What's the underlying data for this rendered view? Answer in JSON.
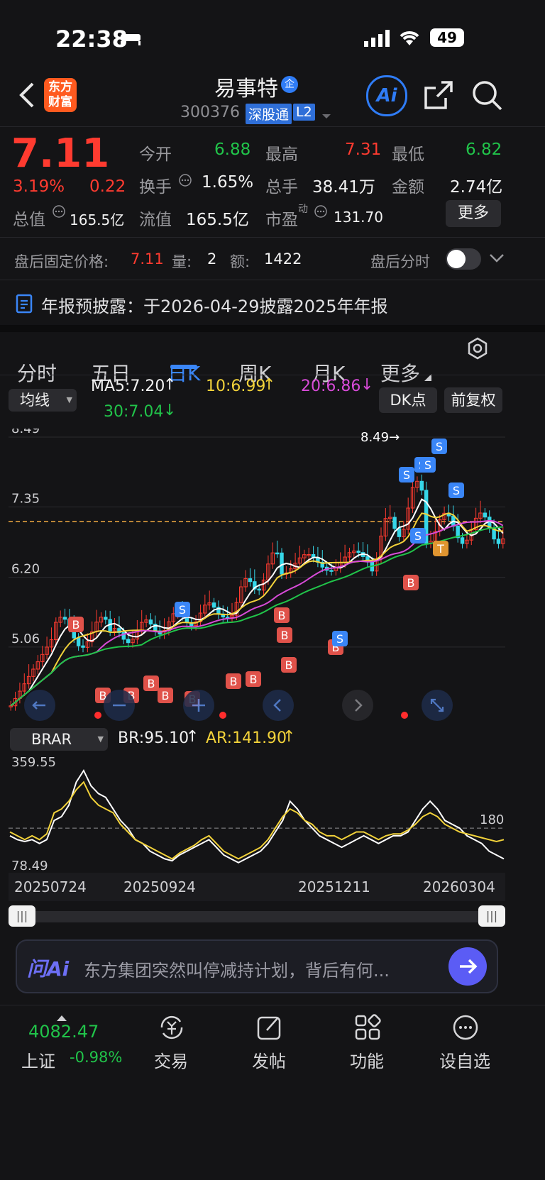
{
  "status_bar": {
    "time": "22:38",
    "battery": "49"
  },
  "header": {
    "logo_text": "东方\n财富",
    "stock_name": "易事特",
    "badge": "企",
    "code": "300376",
    "exchange_tag": "深股通",
    "level_tag": "L2",
    "ai_label": "Ai"
  },
  "quote": {
    "price": "7.11",
    "pct": "3.19%",
    "change": "0.22",
    "open_label": "今开",
    "open": "6.88",
    "high_label": "最高",
    "high": "7.31",
    "low_label": "最低",
    "low": "6.82",
    "turnover_label": "换手",
    "turnover": "1.65%",
    "volume_label": "总手",
    "volume": "38.41万",
    "amount_label": "金额",
    "amount": "2.74亿",
    "mktcap_label": "总值",
    "mktcap": "165.5亿",
    "float_label": "流值",
    "float": "165.5亿",
    "pe_label": "市盈",
    "pe_sup": "动",
    "pe": "131.70",
    "more_button": "更多"
  },
  "after_hours": {
    "price_label": "盘后固定价格:",
    "price": "7.11",
    "vol_label": "量:",
    "vol": "2",
    "amt_label": "额:",
    "amt": "1422",
    "toggle_label": "盘后分时"
  },
  "notice": {
    "text": "年报预披露：于2026-04-29披露2025年年报"
  },
  "tabs": [
    "分时",
    "五日",
    "日K",
    "周K",
    "月K",
    "更多"
  ],
  "active_tab": "日K",
  "ma_bar": {
    "selector": "均线",
    "ma5": "MA5:7.20",
    "ma10": "10:6.99",
    "ma20": "20:6.86",
    "ma30": "30:7.04",
    "dk_button": "DK点",
    "adjust_button": "前复权"
  },
  "chart_data": [
    {
      "type": "candlestick",
      "y_ticks": [
        "8.49",
        "7.35",
        "6.20",
        "5.06"
      ],
      "ylim": [
        3.9,
        8.49
      ],
      "max_annotation": "8.49",
      "reference_price": 7.11,
      "ma_series": [
        {
          "name": "MA5",
          "color": "#ffffff"
        },
        {
          "name": "MA10",
          "color": "#f2d23a"
        },
        {
          "name": "MA20",
          "color": "#d84bd8"
        },
        {
          "name": "MA30",
          "color": "#21c44a"
        }
      ],
      "signals": [
        "B",
        "B",
        "B",
        "B",
        "B",
        "B",
        "B",
        "B",
        "B",
        "B",
        "B",
        "B",
        "S",
        "S",
        "S",
        "S",
        "S",
        "S",
        "S",
        "S",
        "B",
        "T"
      ]
    },
    {
      "type": "line",
      "indicator": "BRAR",
      "br_label": "BR:95.10",
      "ar_label": "AR:141.90",
      "y_ticks": [
        "359.55",
        "180",
        "78.49"
      ],
      "ylim": [
        78.49,
        359.55
      ],
      "x_ticks": [
        "20250724",
        "20250924",
        "20251211",
        "20260304"
      ],
      "series": [
        {
          "name": "BR",
          "values": [
            160,
            150,
            145,
            150,
            140,
            150,
            200,
            210,
            240,
            300,
            330,
            290,
            270,
            260,
            230,
            200,
            180,
            150,
            140,
            120,
            110,
            100,
            95,
            110,
            120,
            130,
            140,
            150,
            130,
            110,
            100,
            90,
            100,
            110,
            120,
            140,
            170,
            200,
            250,
            230,
            200,
            180,
            160,
            150,
            140,
            130,
            140,
            150,
            160,
            150,
            140,
            150,
            160,
            160,
            170,
            200,
            230,
            250,
            230,
            200,
            190,
            180,
            160,
            150,
            140,
            120,
            110,
            100
          ]
        },
        {
          "name": "AR",
          "values": [
            170,
            160,
            150,
            160,
            150,
            165,
            220,
            230,
            250,
            280,
            300,
            260,
            240,
            230,
            220,
            190,
            170,
            150,
            140,
            130,
            120,
            110,
            100,
            115,
            125,
            135,
            150,
            160,
            140,
            120,
            110,
            100,
            110,
            120,
            130,
            150,
            180,
            210,
            230,
            220,
            200,
            190,
            170,
            160,
            160,
            150,
            160,
            170,
            170,
            160,
            150,
            160,
            165,
            165,
            175,
            190,
            210,
            220,
            210,
            190,
            180,
            170,
            165,
            160,
            155,
            150,
            145,
            150
          ]
        }
      ]
    }
  ],
  "chart_controls": [
    "左移",
    "缩小",
    "放大",
    "上一根",
    "下一根",
    "全屏"
  ],
  "ask_ai": {
    "brand": "问Ai",
    "text": "东方集团突然叫停减持计划，背后有何..."
  },
  "bottom_bar": {
    "index_value": "4082.47",
    "index_name": "上证",
    "index_pct": "-0.98%",
    "items": [
      "交易",
      "发帖",
      "功能",
      "设自选"
    ]
  },
  "colors": {
    "up": "#ff3b30",
    "down": "#21c44a",
    "accent": "#2f7cf6",
    "background": "#141416"
  }
}
